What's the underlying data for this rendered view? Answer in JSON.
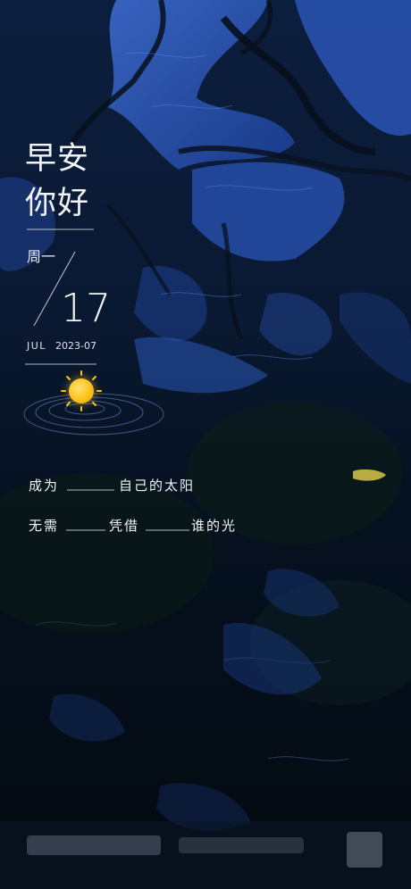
{
  "greeting": {
    "line1": "早安",
    "line2": "你好"
  },
  "date": {
    "weekday": "周一",
    "day": "17",
    "month": "JUL",
    "year": "2023-07"
  },
  "quote": {
    "line1": {
      "part1": "成为",
      "part2": "自己的太阳"
    },
    "line2": {
      "part1": "无需",
      "part2": "凭借",
      "part3": "谁的光"
    }
  },
  "colors": {
    "sun": "#ffc21a",
    "water": "#1f4fae",
    "dark": "#05101d"
  }
}
